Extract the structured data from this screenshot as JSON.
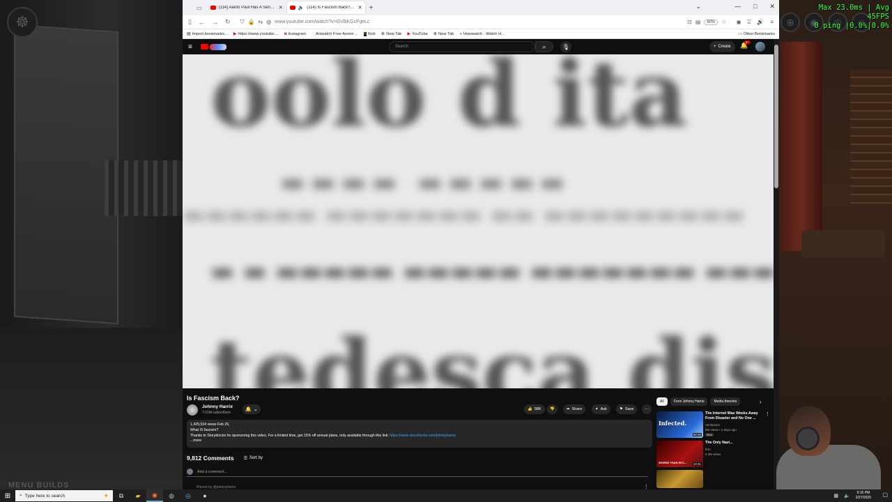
{
  "overlay": {
    "fps_line1": "Max  23.0ms | Avg  45FPS",
    "fps_line2": "0 ping  |0.0%|0.0%",
    "menu_ghost": "MENU   BUILDS"
  },
  "browser": {
    "tabs": [
      {
        "title": "(114) Aaron Paul Has A Serious",
        "active": false
      },
      {
        "title": "(114) Is Fascism Back? - You",
        "active": true
      }
    ],
    "url": "www.youtube.com/watch?v=GVBKGcFqeLc",
    "zoom": "80%",
    "bookmarks": [
      {
        "label": "Import bookmarks...",
        "icon": "file-icon"
      },
      {
        "label": "https://www.youtube....",
        "icon": "youtube-icon"
      },
      {
        "label": "Instagram",
        "icon": "instagram-icon"
      },
      {
        "label": "Aniwatch Free Anime ...",
        "icon": "aniwatch-icon"
      },
      {
        "label": "Kick",
        "icon": "kick-icon"
      },
      {
        "label": "New Tab",
        "icon": "globe-icon"
      },
      {
        "label": "YouTube",
        "icon": "youtube-icon"
      },
      {
        "label": "New Tab",
        "icon": "globe-icon"
      },
      {
        "label": "Hianwatch - Watch H...",
        "icon": "hianime-icon"
      }
    ],
    "other_bookmarks": "Other Bookmarks"
  },
  "youtube": {
    "search_placeholder": "Search",
    "create_label": "Create",
    "notif_count": "9+",
    "video": {
      "frame_text": [
        "oolo d ita",
        "tedesca distri"
      ],
      "title": "Is Fascism Back?",
      "channel": "Johnny Harris",
      "subscribers": "7.51M subscribers",
      "likes": "58K",
      "share": "Share",
      "ask": "Ask",
      "save": "Save",
      "views_date": "1,425,534 views  Feb 26,",
      "desc_line1": "What IS fascism?",
      "desc_line2": "Thanks to Storyblocks for sponsoring this video. For a limited time, get 15% off annual plans, only available through this link: ",
      "desc_link": "https://www.storyblocks.com/johnnyharris",
      "desc_more": "...more"
    },
    "comments": {
      "count": "9,812 Comments",
      "sort_label": "Sort by",
      "add_placeholder": "Add a comment...",
      "pinned": "Pinned by @johnnyharris"
    },
    "chips": [
      "All",
      "From Johnny Harris",
      "Media theories"
    ],
    "recommendations": [
      {
        "title": "The Internet Was Weeks Away From Disaster and No One ...",
        "channel": "Veritasium",
        "meta": "6M views • 2 days ago",
        "badge": "New",
        "duration": "50:00",
        "thumb_text": "Infected."
      },
      {
        "title": "The Only Nazi...",
        "channel": "fern",
        "meta": "2.3M views",
        "badge": "",
        "duration": "10:31",
        "thumb_text": "WORSE THAN HITL..."
      },
      {
        "title": "",
        "channel": "",
        "meta": "",
        "badge": "",
        "duration": "",
        "thumb_text": ""
      }
    ]
  },
  "taskbar": {
    "search_placeholder": "Type here to search",
    "time": "9:15 PM",
    "date": "2/27/2025"
  }
}
